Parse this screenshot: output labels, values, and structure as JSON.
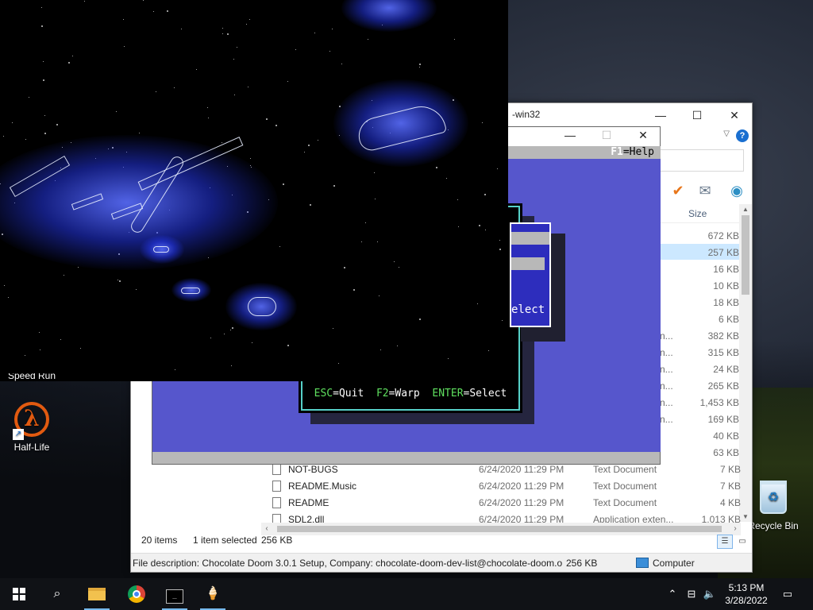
{
  "desktop": {
    "icons": [
      {
        "label": "Half-Life",
        "icon": "half-life-icon"
      },
      {
        "label": "Recycle Bin",
        "icon": "recycle-bin-icon"
      }
    ],
    "partial_label": "Speed Run"
  },
  "explorer": {
    "title": "-win32",
    "column_size": "Size",
    "sizes": [
      "672 KB",
      "257 KB",
      "16 KB",
      "10 KB",
      "18 KB",
      "6 KB",
      "382 KB",
      "315 KB",
      "24 KB",
      "265 KB",
      "1,453 KB",
      "169 KB",
      "40 KB",
      "63 KB"
    ],
    "truncated_type": "n...",
    "files": [
      {
        "name": "NOT-BUGS",
        "date": "6/24/2020 11:29 PM",
        "type": "Text Document",
        "size": "7 KB"
      },
      {
        "name": "README.Music",
        "date": "6/24/2020 11:29 PM",
        "type": "Text Document",
        "size": "7 KB"
      },
      {
        "name": "README",
        "date": "6/24/2020 11:29 PM",
        "type": "Text Document",
        "size": "4 KB"
      },
      {
        "name": "SDL2.dll",
        "date": "6/24/2020 11:29 PM",
        "type": "Application exten...",
        "size": "1,013 KB"
      }
    ],
    "status": {
      "items": "20 items",
      "selected": "1 item selected",
      "selected_size": "256 KB"
    },
    "description": {
      "text": "File description: Chocolate Doom 3.0.1 Setup, Company: chocolate-doom-dev-list@chocolate-doom.o",
      "size": "256 KB",
      "location": "Computer"
    }
  },
  "setup": {
    "help": "F1=Help",
    "help_key": "F1",
    "help_rest": "=Help",
    "keys": {
      "esc_key": "ESC",
      "esc_label": "=Quit",
      "f2_key": "F2",
      "f2_label": "=Warp",
      "enter_key": "ENTER",
      "enter_label": "=Select"
    },
    "sub_label": "elect"
  },
  "taskbar": {
    "time": "5:13 PM",
    "date": "3/28/2022",
    "apps": [
      "start-icon",
      "search-icon",
      "file-explorer-icon",
      "chrome-icon",
      "terminal-icon",
      "doom-setup-icon"
    ]
  },
  "colors": {
    "dos_blue": "#5656cc",
    "dos_cyan": "#56d0c8",
    "dos_green": "#5fe05f",
    "selection": "#cce8ff"
  }
}
